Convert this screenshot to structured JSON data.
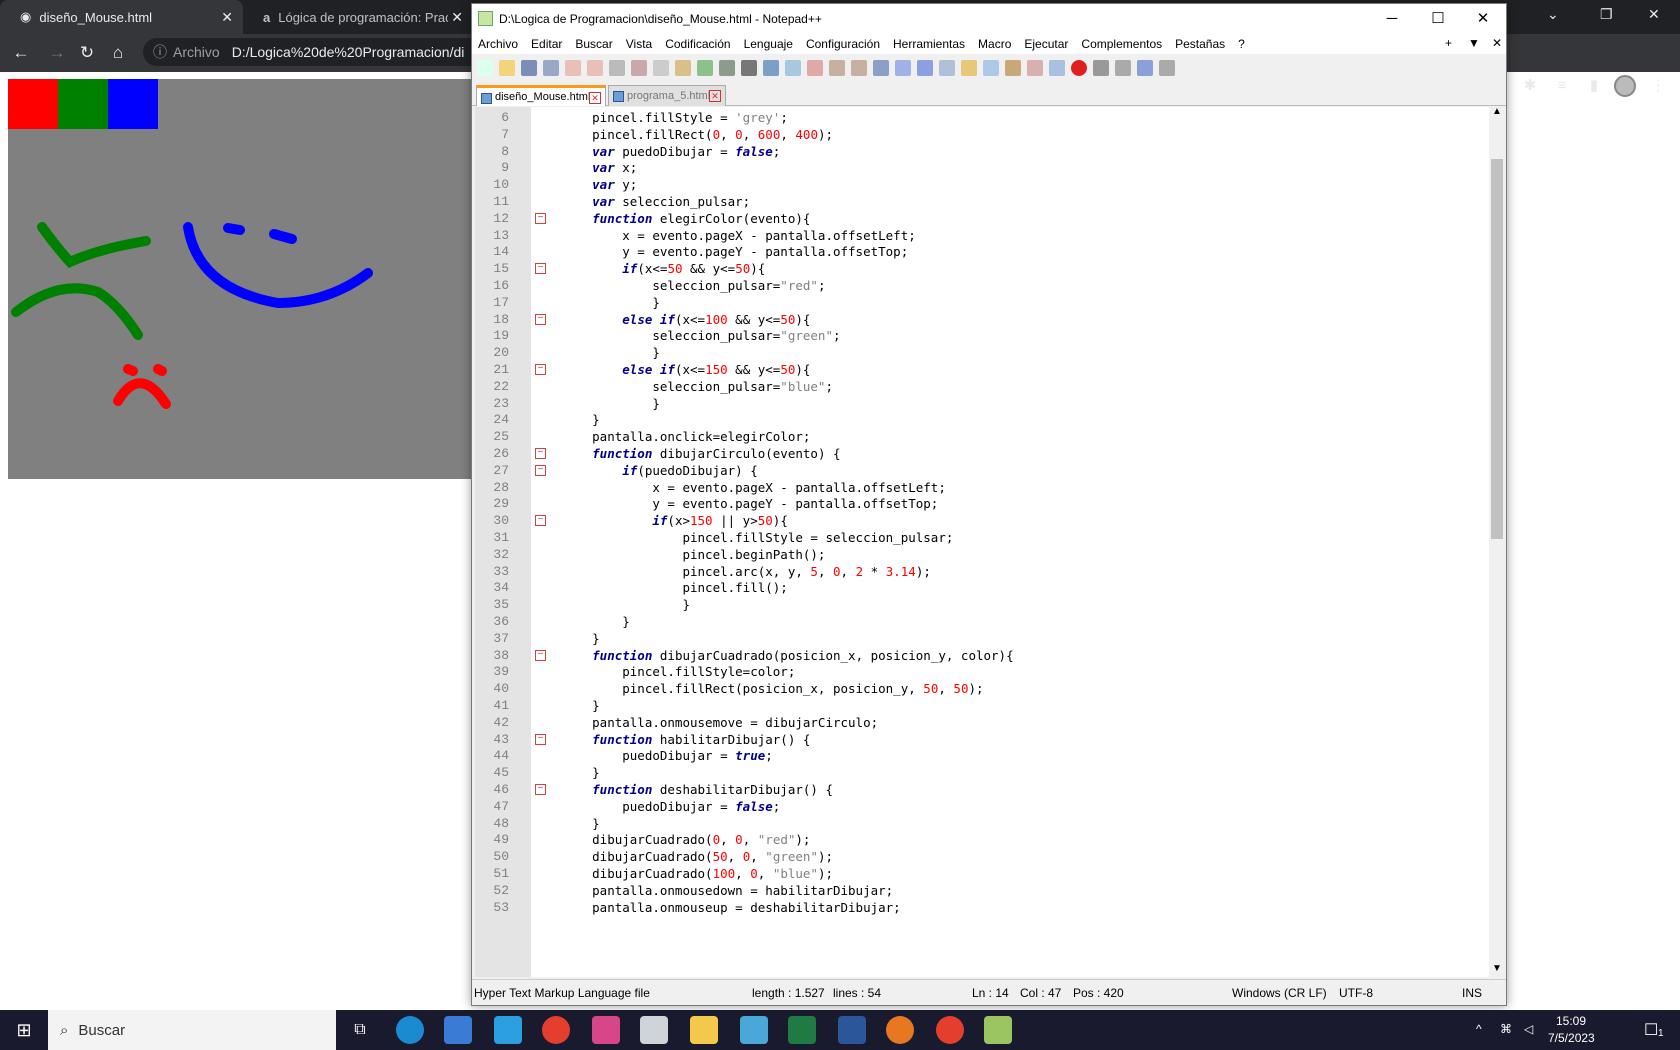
{
  "browser": {
    "tabs": [
      {
        "title": "diseño_Mouse.html"
      },
      {
        "title": "Lógica de programación: Practic"
      }
    ],
    "omnibox": {
      "label": "Archivo",
      "url": "D:/Logica%20de%20Programacion/di"
    }
  },
  "canvas": {
    "swatch_colors": [
      "#ff0000",
      "#008000",
      "#0000ff"
    ],
    "background": "#808080"
  },
  "notepad": {
    "title": "D:\\Logica de Programacion\\diseño_Mouse.html - Notepad++",
    "menu": [
      "Archivo",
      "Editar",
      "Buscar",
      "Vista",
      "Codificación",
      "Lenguaje",
      "Configuración",
      "Herramientas",
      "Macro",
      "Ejecutar",
      "Complementos",
      "Pestañas",
      "?"
    ],
    "tabs": [
      {
        "label": "diseño_Mouse.html"
      },
      {
        "label": "programa_5.html"
      }
    ],
    "status": {
      "filetype": "Hyper Text Markup Language file",
      "length": "length : 1.527",
      "lines": "lines : 54",
      "ln": "Ln : 14",
      "col": "Col : 47",
      "pos": "Pos : 420",
      "eol": "Windows (CR LF)",
      "encoding": "UTF-8",
      "mode": "INS"
    }
  },
  "code_lines": [
    {
      "n": "6",
      "t": "      pincel.fillStyle = 'grey';"
    },
    {
      "n": "7",
      "t": "      pincel.fillRect(0, 0, 600, 400);"
    },
    {
      "n": "8",
      "t": "      var puedoDibujar = false;"
    },
    {
      "n": "9",
      "t": "      var x;"
    },
    {
      "n": "10",
      "t": "      var y;"
    },
    {
      "n": "11",
      "t": "      var seleccion_pulsar;"
    },
    {
      "n": "12",
      "t": "      function elegirColor(evento){"
    },
    {
      "n": "13",
      "t": "          x = evento.pageX - pantalla.offsetLeft;"
    },
    {
      "n": "14",
      "t": "          y = evento.pageY - pantalla.offsetTop;"
    },
    {
      "n": "15",
      "t": "          if(x<=50 && y<=50){"
    },
    {
      "n": "16",
      "t": "              seleccion_pulsar=\"red\";"
    },
    {
      "n": "17",
      "t": "              }"
    },
    {
      "n": "18",
      "t": "          else if(x<=100 && y<=50){"
    },
    {
      "n": "19",
      "t": "              seleccion_pulsar=\"green\";"
    },
    {
      "n": "20",
      "t": "              }"
    },
    {
      "n": "21",
      "t": "          else if(x<=150 && y<=50){"
    },
    {
      "n": "22",
      "t": "              seleccion_pulsar=\"blue\";"
    },
    {
      "n": "23",
      "t": "              }"
    },
    {
      "n": "24",
      "t": "      }"
    },
    {
      "n": "25",
      "t": "      pantalla.onclick=elegirColor;"
    },
    {
      "n": "26",
      "t": "      function dibujarCirculo(evento) {"
    },
    {
      "n": "27",
      "t": "          if(puedoDibujar) {"
    },
    {
      "n": "28",
      "t": "              x = evento.pageX - pantalla.offsetLeft;"
    },
    {
      "n": "29",
      "t": "              y = evento.pageY - pantalla.offsetTop;"
    },
    {
      "n": "30",
      "t": "              if(x>150 || y>50){"
    },
    {
      "n": "31",
      "t": "                  pincel.fillStyle = seleccion_pulsar;"
    },
    {
      "n": "32",
      "t": "                  pincel.beginPath();"
    },
    {
      "n": "33",
      "t": "                  pincel.arc(x, y, 5, 0, 2 * 3.14);"
    },
    {
      "n": "34",
      "t": "                  pincel.fill();"
    },
    {
      "n": "35",
      "t": "                  }"
    },
    {
      "n": "36",
      "t": "          }"
    },
    {
      "n": "37",
      "t": "      }"
    },
    {
      "n": "38",
      "t": "      function dibujarCuadrado(posicion_x, posicion_y, color){"
    },
    {
      "n": "39",
      "t": "          pincel.fillStyle=color;"
    },
    {
      "n": "40",
      "t": "          pincel.fillRect(posicion_x, posicion_y, 50, 50);"
    },
    {
      "n": "41",
      "t": "      }"
    },
    {
      "n": "42",
      "t": "      pantalla.onmousemove = dibujarCirculo;"
    },
    {
      "n": "43",
      "t": "      function habilitarDibujar() {"
    },
    {
      "n": "44",
      "t": "          puedoDibujar = true;"
    },
    {
      "n": "45",
      "t": "      }"
    },
    {
      "n": "46",
      "t": "      function deshabilitarDibujar() {"
    },
    {
      "n": "47",
      "t": "          puedoDibujar = false;"
    },
    {
      "n": "48",
      "t": "      }"
    },
    {
      "n": "49",
      "t": "      dibujarCuadrado(0, 0, \"red\");"
    },
    {
      "n": "50",
      "t": "      dibujarCuadrado(50, 0, \"green\");"
    },
    {
      "n": "51",
      "t": "      dibujarCuadrado(100, 0, \"blue\");"
    },
    {
      "n": "52",
      "t": "      pantalla.onmousedown = habilitarDibujar;"
    },
    {
      "n": "53",
      "t": "      pantalla.onmouseup = deshabilitarDibujar;"
    }
  ],
  "taskbar": {
    "search_placeholder": "Buscar",
    "time": "15:09",
    "date": "7/5/2023",
    "notif_count": "1"
  }
}
